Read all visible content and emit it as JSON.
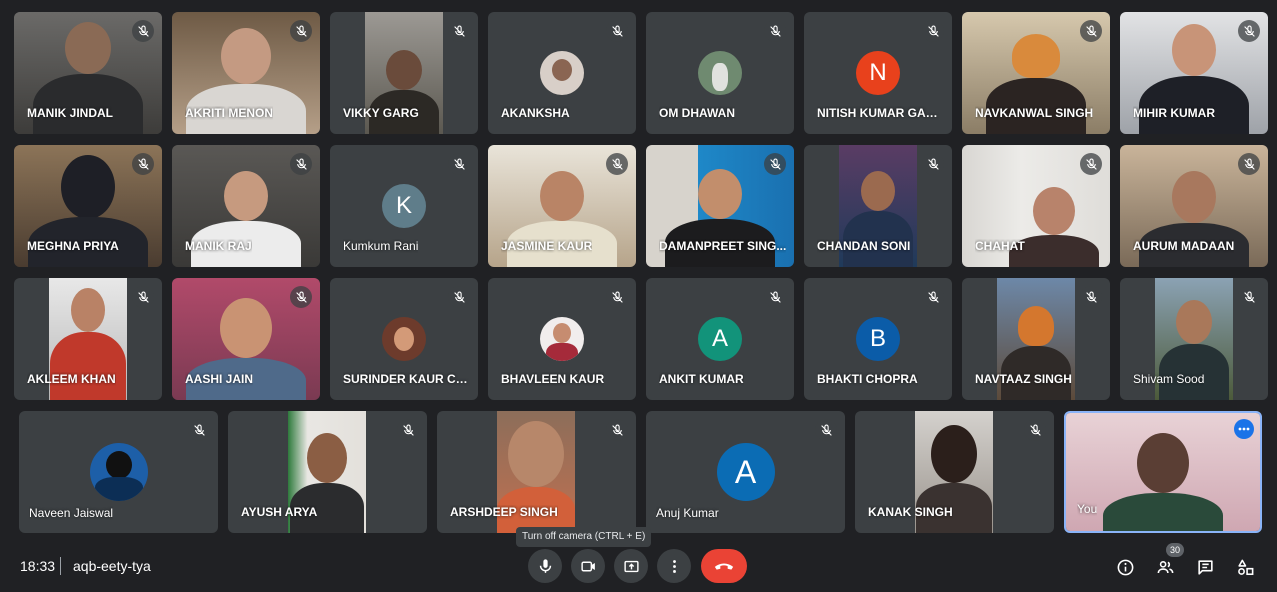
{
  "colors": {
    "background": "#202124",
    "tile": "#3c4043",
    "end_call": "#ea4335",
    "self_border": "#8ab4f8"
  },
  "participants": [
    {
      "name": "MANIK JINDAL"
    },
    {
      "name": "AKRITI MENON"
    },
    {
      "name": "VIKKY GARG"
    },
    {
      "name": "AKANKSHA"
    },
    {
      "name": "OM DHAWAN"
    },
    {
      "name": "NITISH KUMAR GAUT...",
      "initial": "N"
    },
    {
      "name": "NAVKANWAL SINGH"
    },
    {
      "name": "MIHIR KUMAR"
    },
    {
      "name": "MEGHNA PRIYA"
    },
    {
      "name": "MANIK RAJ"
    },
    {
      "name": "Kumkum Rani",
      "initial": "K"
    },
    {
      "name": "JASMINE KAUR"
    },
    {
      "name": "DAMANPREET SING..."
    },
    {
      "name": "CHANDAN SONI"
    },
    {
      "name": "CHAHAT"
    },
    {
      "name": "AURUM MADAAN"
    },
    {
      "name": "AKLEEM KHAN"
    },
    {
      "name": "AASHI JAIN"
    },
    {
      "name": "SURINDER KAUR CHA..."
    },
    {
      "name": "BHAVLEEN KAUR"
    },
    {
      "name": "ANKIT KUMAR",
      "initial": "A"
    },
    {
      "name": "BHAKTI CHOPRA",
      "initial": "B"
    },
    {
      "name": "NAVTAAZ SINGH"
    },
    {
      "name": "Shivam Sood"
    },
    {
      "name": "Naveen Jaiswal"
    },
    {
      "name": "AYUSH ARYA"
    },
    {
      "name": "ARSHDEEP SINGH"
    },
    {
      "name": "Anuj Kumar",
      "initial": "A"
    },
    {
      "name": "KANAK SINGH"
    },
    {
      "name": "You"
    }
  ],
  "meeting": {
    "time": "18:33",
    "code": "aqb-eety-tya"
  },
  "tooltip": "Turn off camera (CTRL + E)",
  "participant_count": "30",
  "icons": [
    "mic-off-icon",
    "mic-icon",
    "camera-icon",
    "present-icon",
    "more-vert-icon",
    "end-call-icon",
    "info-icon",
    "people-icon",
    "chat-icon",
    "activities-icon"
  ]
}
